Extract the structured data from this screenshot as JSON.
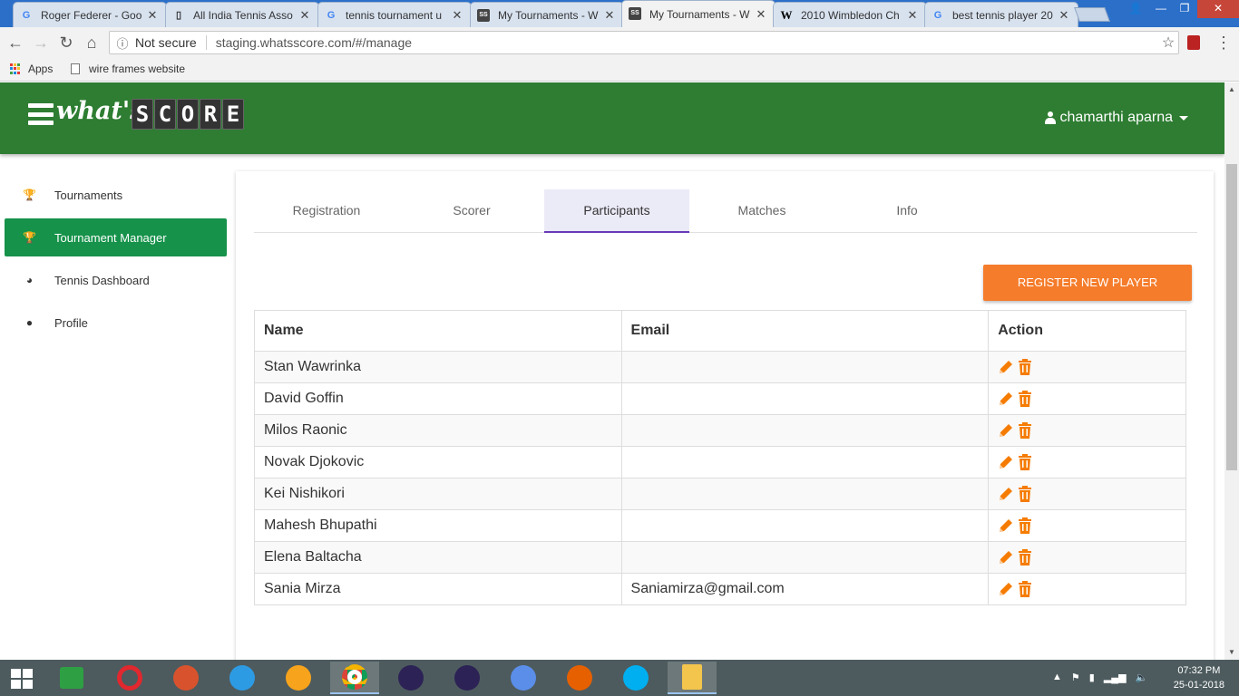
{
  "browser": {
    "tabs": [
      {
        "favicon": "google",
        "title": "Roger Federer - Goo"
      },
      {
        "favicon": "page",
        "title": "All India Tennis Asso"
      },
      {
        "favicon": "google",
        "title": "tennis tournament u"
      },
      {
        "favicon": "whatsscore",
        "title": "My Tournaments - W"
      },
      {
        "favicon": "whatsscore",
        "title": "My Tournaments - W",
        "active": true
      },
      {
        "favicon": "wikipedia",
        "title": "2010 Wimbledon Ch"
      },
      {
        "favicon": "google",
        "title": "best tennis player 20"
      }
    ],
    "security_label": "Not secure",
    "url": "staging.whatsscore.com/#/manage",
    "bookmarks": [
      {
        "label": "Apps"
      },
      {
        "label": "wire frames website"
      }
    ]
  },
  "app": {
    "brand_prefix": "what's",
    "brand_letters": [
      "S",
      "C",
      "O",
      "R",
      "E"
    ],
    "user_name": "chamarthi aparna",
    "accent_color": "#2e7d32"
  },
  "sidebar": {
    "items": [
      {
        "label": "Tournaments",
        "icon": "trophy-icon"
      },
      {
        "label": "Tournament Manager",
        "icon": "trophy-icon",
        "active": true
      },
      {
        "label": "Tennis Dashboard",
        "icon": "dashboard-icon"
      },
      {
        "label": "Profile",
        "icon": "user-icon"
      }
    ]
  },
  "tabs": [
    {
      "label": "Registration"
    },
    {
      "label": "Scorer"
    },
    {
      "label": "Participants",
      "active": true
    },
    {
      "label": "Matches"
    },
    {
      "label": "Info"
    }
  ],
  "register_button": "REGISTER NEW PLAYER",
  "table": {
    "headers": [
      "Name",
      "Email",
      "Action"
    ],
    "rows": [
      {
        "name": "Stan Wawrinka",
        "email": ""
      },
      {
        "name": "David Goffin",
        "email": ""
      },
      {
        "name": "Milos Raonic",
        "email": ""
      },
      {
        "name": "Novak Djokovic",
        "email": ""
      },
      {
        "name": "Kei Nishikori",
        "email": ""
      },
      {
        "name": "Mahesh Bhupathi",
        "email": ""
      },
      {
        "name": "Elena Baltacha",
        "email": ""
      },
      {
        "name": "Sania Mirza",
        "email": "Saniamirza@gmail.com"
      }
    ]
  },
  "taskbar": {
    "time": "07:32 PM",
    "date": "25-01-2018"
  }
}
